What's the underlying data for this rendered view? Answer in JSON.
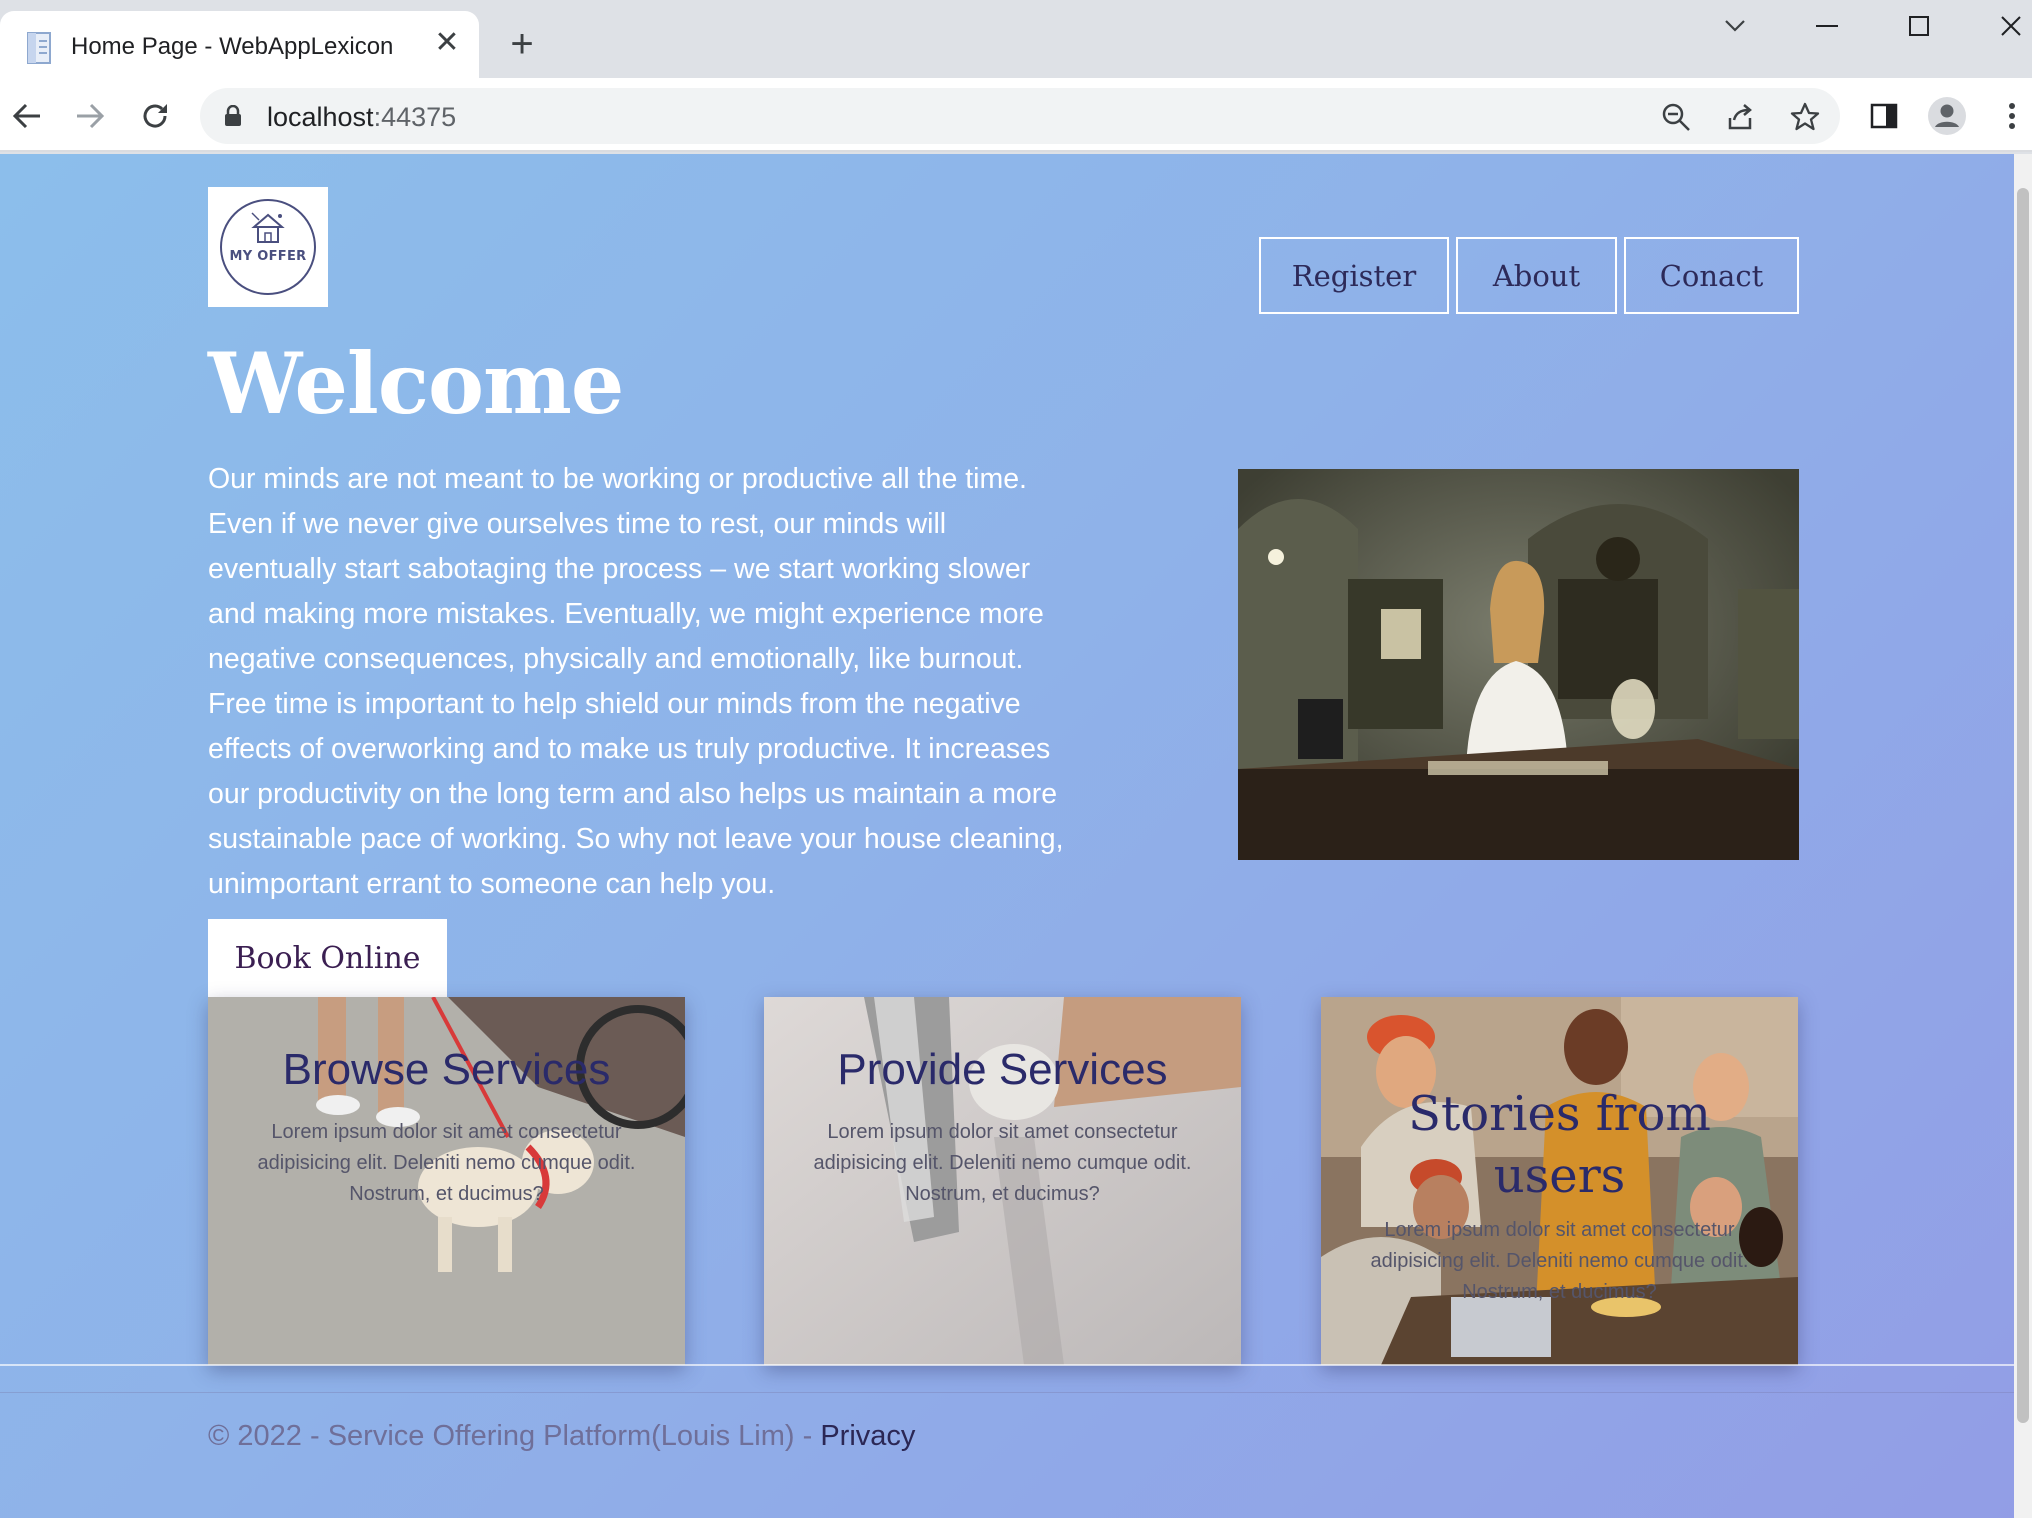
{
  "browser": {
    "tab_title": "Home Page - WebAppLexicon",
    "url_host": "localhost",
    "url_port": ":44375"
  },
  "header": {
    "logo_text": "MY OFFER",
    "nav": [
      "Register",
      "About",
      "Conact"
    ]
  },
  "hero": {
    "title": "Welcome",
    "text": "Our minds are not meant to be working or productive all the time. Even if we never give ourselves time to rest, our minds will eventually start sabotaging the process – we start working slower and making more mistakes. Eventually, we might experience more negative consequences, physically and emotionally, like burnout. Free time is important to help shield our minds from the negative effects of overworking and to make us truly productive. It increases our productivity on the long term and also helps us maintain a more sustainable pace of working. So why not leave your house cleaning, unimportant errant to someone can help you.",
    "button": "Book Online"
  },
  "cards": [
    {
      "title": "Browse Services",
      "text": "Lorem ipsum dolor sit amet consectetur adipisicing elit. Deleniti nemo cumque odit. Nostrum, et ducimus?"
    },
    {
      "title": "Provide Services",
      "text": "Lorem ipsum dolor sit amet consectetur adipisicing elit. Deleniti nemo cumque odit. Nostrum, et ducimus?"
    },
    {
      "title": "Stories from users",
      "text": "Lorem ipsum dolor sit amet consectetur adipisicing elit. Deleniti nemo cumque odit. Nostrum, et ducimus?"
    }
  ],
  "footer": {
    "text": "© 2022 - Service Offering Platform(Louis Lim) - ",
    "link": "Privacy"
  }
}
